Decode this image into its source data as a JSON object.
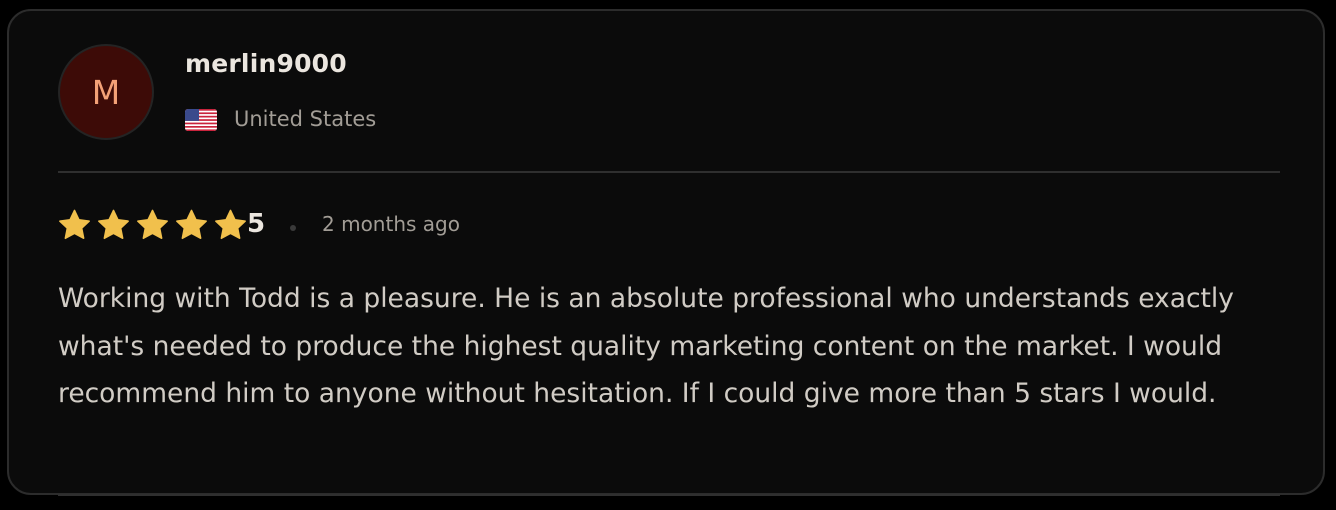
{
  "reviewer": {
    "avatar_initial": "M",
    "username": "merlin9000",
    "country": "United States",
    "flag_icon": "us-flag-icon"
  },
  "review": {
    "rating": 5,
    "rating_label": "5",
    "time_ago": "2 months ago",
    "text": "Working with Todd is a pleasure. He is an absolute professional who understands exactly what's needed to produce the highest quality marketing content on the market. I would recommend him to anyone without hesitation. If I could give more than 5 stars I would."
  },
  "colors": {
    "star": "#f1c04c",
    "avatar_bg": "#3d0b07",
    "avatar_text": "#f3a177"
  }
}
